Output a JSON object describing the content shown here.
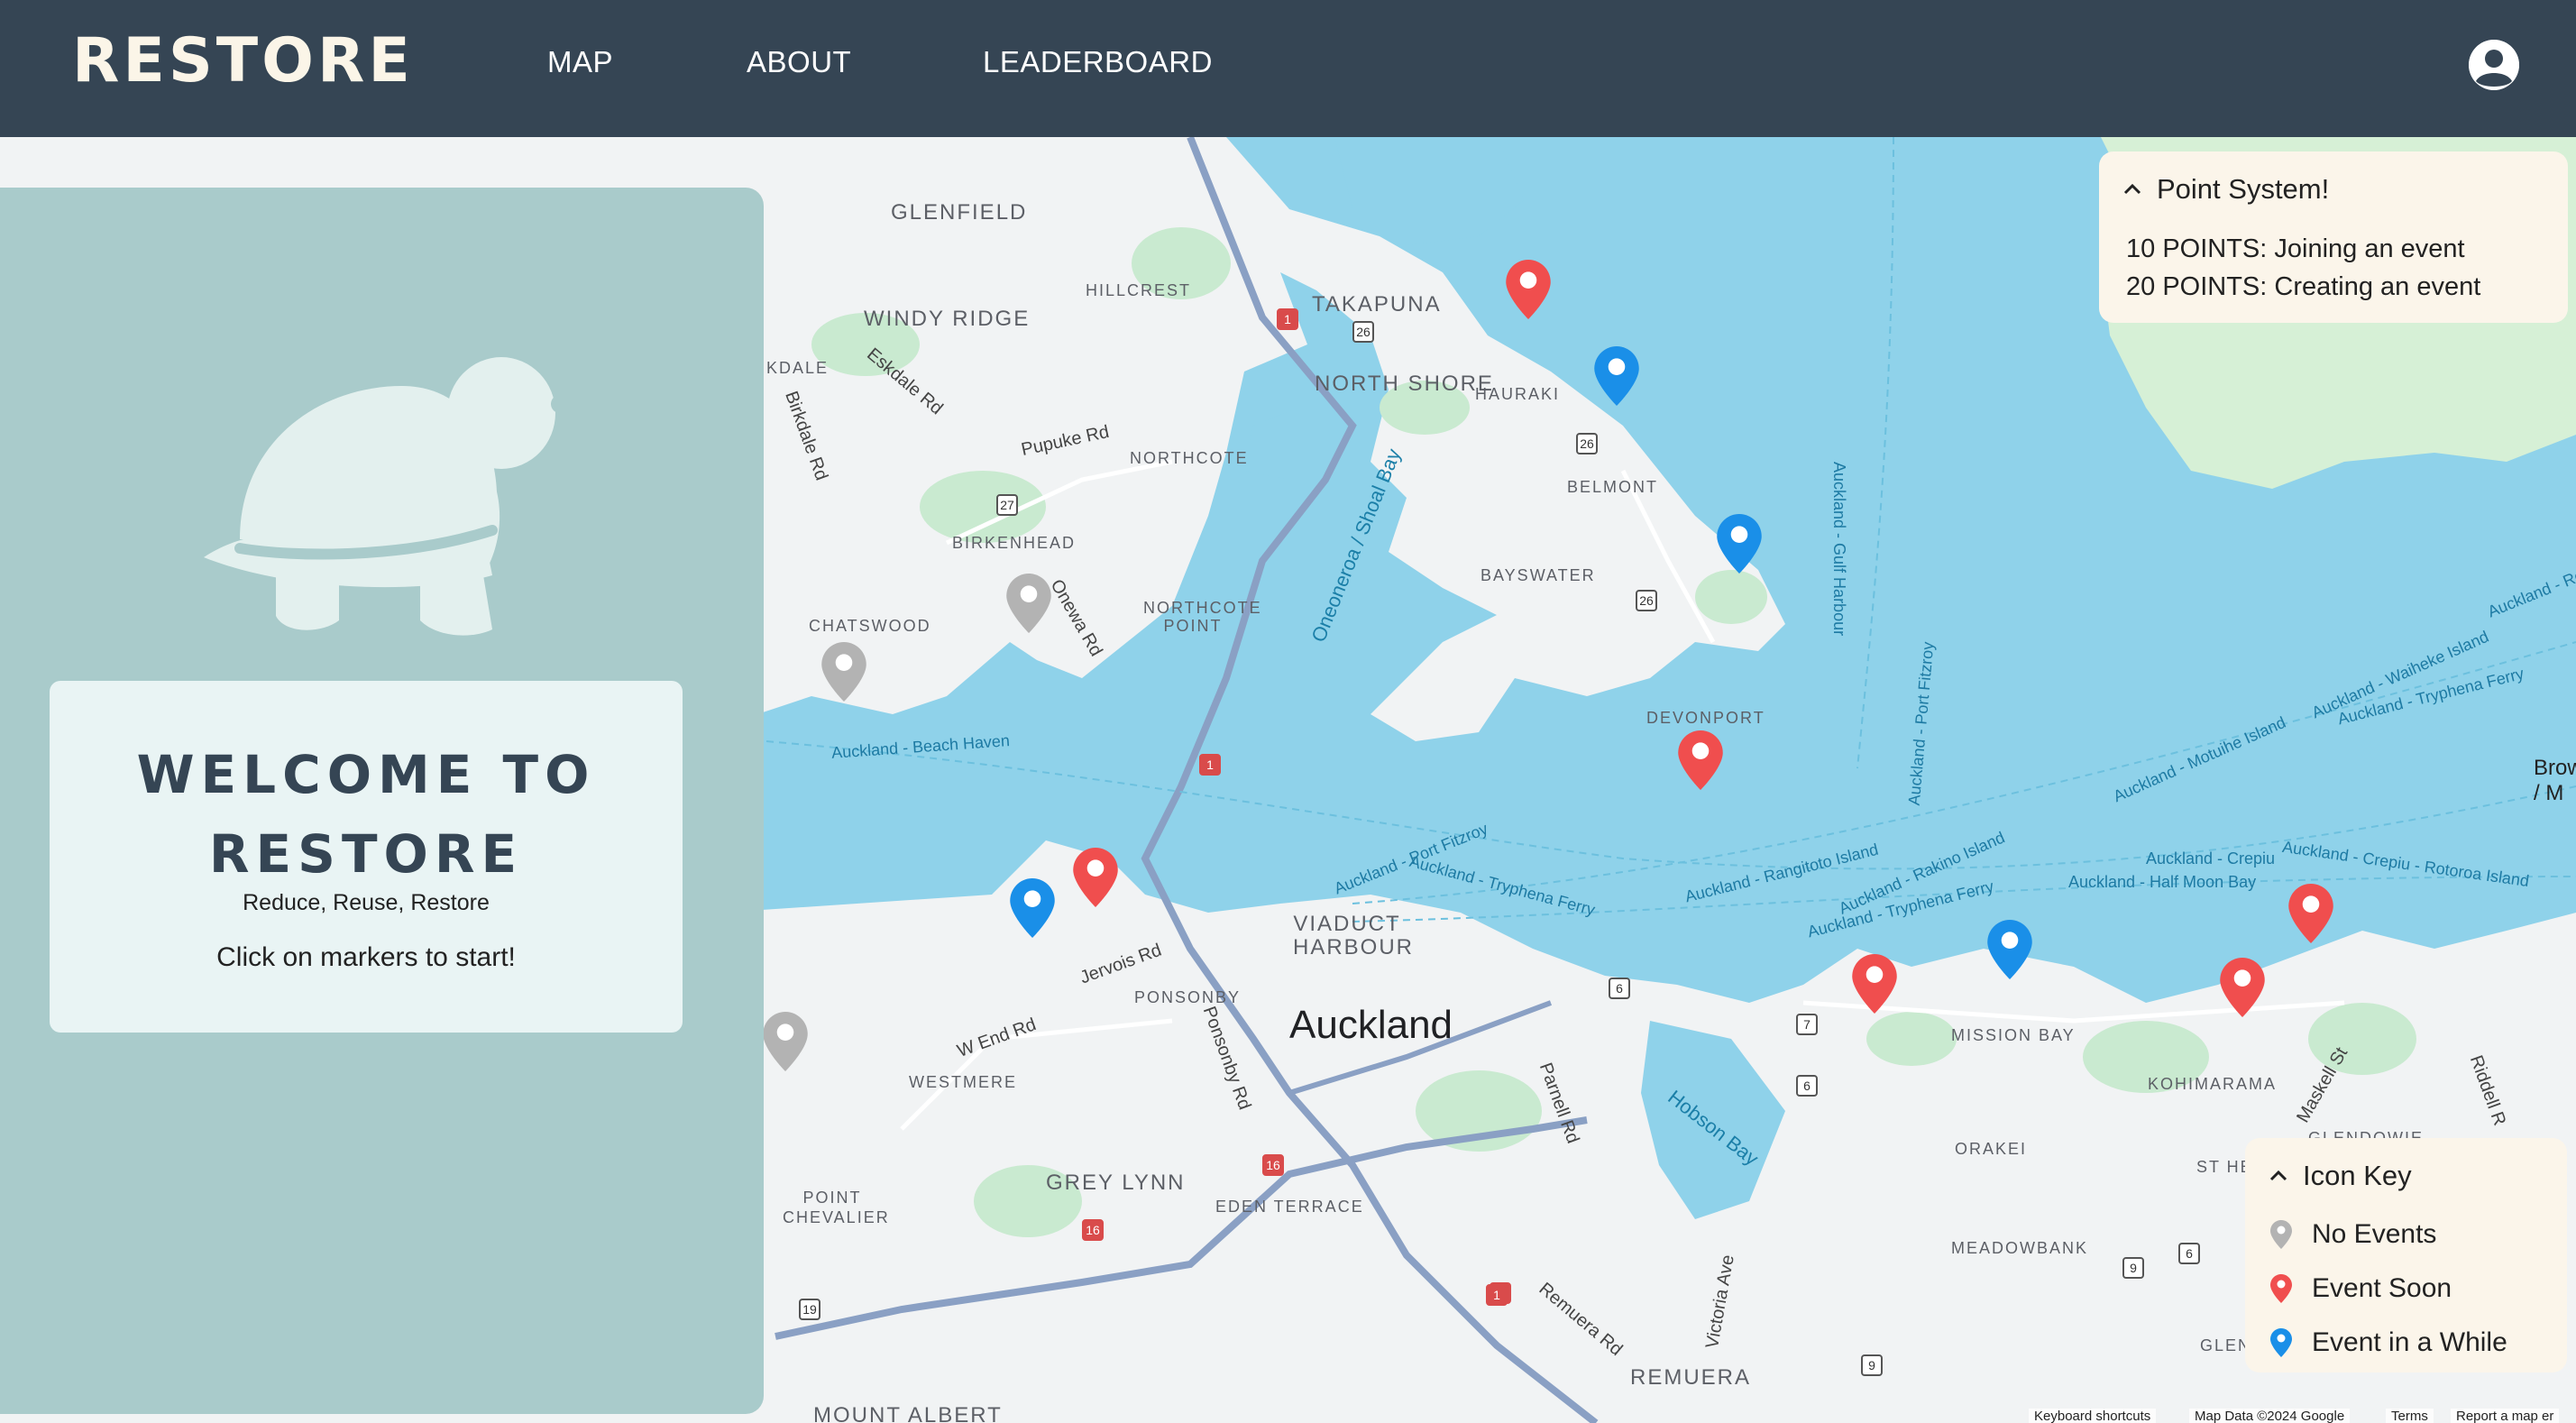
{
  "navbar": {
    "brand": "RESTORE",
    "links": [
      {
        "label": "MAP"
      },
      {
        "label": "ABOUT"
      },
      {
        "label": "LEADERBOARD"
      }
    ],
    "user_icon": "user-circle-icon",
    "background": "#354554"
  },
  "left_panel": {
    "logo_icon": "turtle-icon",
    "welcome_title": "WELCOME TO RESTORE",
    "tagline": "Reduce, Reuse, Restore",
    "cta": "Click on markers to start!"
  },
  "point_system": {
    "title": "Point System!",
    "lines": [
      "10 POINTS: Joining an event",
      "20 POINTS: Creating an event"
    ]
  },
  "icon_key": {
    "title": "Icon Key",
    "items": [
      {
        "label": "No Events",
        "color": "#b3b3b3"
      },
      {
        "label": "Event Soon",
        "color": "#f04e4e"
      },
      {
        "label": "Event in a While",
        "color": "#1a8fe8"
      }
    ]
  },
  "map": {
    "city": "Auckland",
    "places": [
      "GLENFIELD",
      "WINDY RIDGE",
      "HILLCREST",
      "TAKAPUNA",
      "NORTH SHORE",
      "HAURAKI",
      "NORTHCOTE",
      "BELMONT",
      "BIRKENHEAD",
      "BAYSWATER",
      "CHATSWOOD",
      "NORTHCOTE POINT",
      "DEVONPORT",
      "VIADUCT HARBOUR",
      "PONSONBY",
      "WESTMERE",
      "GREY LYNN",
      "EDEN TERRACE",
      "POINT CHEVALIER",
      "MISSION BAY",
      "KOHIMARAMA",
      "ORAKEI",
      "MEADOWBANK",
      "ST HE",
      "GLENDOWIE",
      "REMUERA",
      "MOUNT ALBERT",
      "GLEN",
      "KDALE"
    ],
    "roads": [
      "Eskdale Rd",
      "Birkdale Rd",
      "Pupuke Rd",
      "Onewa Rd",
      "Jervois Rd",
      "W End Rd",
      "Ponsonby Rd",
      "Parnell Rd",
      "Remuera Rd",
      "Victoria Ave",
      "Maskell St",
      "Riddell R"
    ],
    "water": [
      "Oneoneroa / Shoal Bay",
      "Hobson Bay",
      "Auckland - Beach Haven",
      "Auckland - Gulf Harbour",
      "Auckland - Port Fitzroy",
      "Auckland - Port Fitzroy",
      "Auckland - Tryphena Ferry",
      "Auckland - Rangitoto Island",
      "Auckland - Rakino Island",
      "Auckland - Tryphena Ferry",
      "Auckland - Half Moon Bay",
      "Auckland - Crepiu",
      "Auckland - Crepiu - Rotoroa Island",
      "Auckland - Motuihe Island",
      "Auckland - Waiheke Island",
      "Auckland - Tryphena Ferry",
      "Auckland - Re",
      "Brow / M"
    ],
    "shields": [
      "1",
      "26",
      "26",
      "27",
      "26",
      "1",
      "1",
      "16",
      "16",
      "6",
      "7",
      "6",
      "9",
      "6",
      "19",
      "9",
      "1"
    ],
    "markers": [
      {
        "status": "event-soon",
        "color": "#f04e4e"
      },
      {
        "status": "event-in-a-while",
        "color": "#1a8fe8"
      },
      {
        "status": "event-in-a-while",
        "color": "#1a8fe8"
      },
      {
        "status": "no-events",
        "color": "#b3b3b3"
      },
      {
        "status": "no-events",
        "color": "#b3b3b3"
      },
      {
        "status": "event-soon",
        "color": "#f04e4e"
      },
      {
        "status": "event-soon",
        "color": "#f04e4e"
      },
      {
        "status": "event-in-a-while",
        "color": "#1a8fe8"
      },
      {
        "status": "no-events",
        "color": "#b3b3b3"
      },
      {
        "status": "event-soon",
        "color": "#f04e4e"
      },
      {
        "status": "event-in-a-while",
        "color": "#1a8fe8"
      },
      {
        "status": "event-soon",
        "color": "#f04e4e"
      },
      {
        "status": "event-soon",
        "color": "#f04e4e"
      }
    ],
    "attribution": [
      "Keyboard shortcuts",
      "Map Data ©2024 Google",
      "Terms",
      "Report a map er"
    ]
  }
}
